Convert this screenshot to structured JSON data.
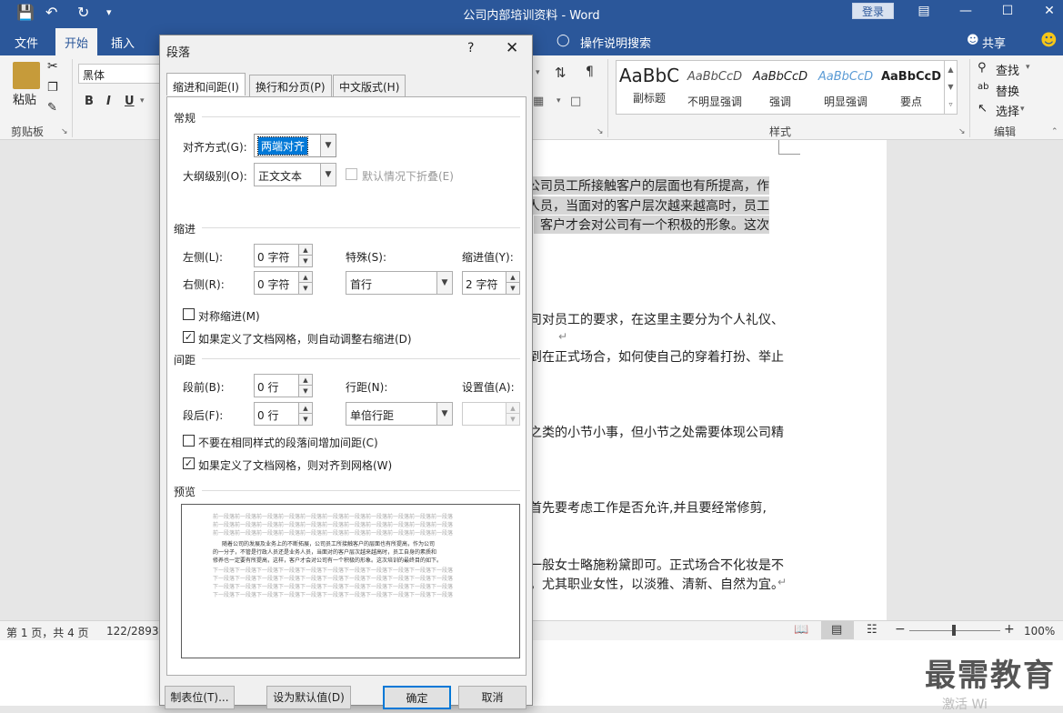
{
  "titlebar": {
    "title": "公司内部培训资料 - Word",
    "login": "登录"
  },
  "ribbon_tabs": [
    "文件",
    "开始",
    "插入",
    "操作说明搜索",
    "共享"
  ],
  "ribbon": {
    "paste": "粘贴",
    "clipboard": "剪贴板",
    "font_name": "黑体",
    "bold": "B",
    "italic": "I",
    "underline": "U",
    "styles_label": "样式",
    "styles": [
      {
        "sample": "AaBbC",
        "name": "副标题"
      },
      {
        "sample": "AaBbCcD",
        "name": "不明显强调"
      },
      {
        "sample": "AaBbCcD",
        "name": "强调"
      },
      {
        "sample": "AaBbCcD",
        "name": "明显强调"
      },
      {
        "sample": "AaBbCcD",
        "name": "要点"
      }
    ],
    "find": "查找",
    "replace": "替换",
    "select": "选择",
    "editing_label": "编辑"
  },
  "document": {
    "lines": [
      "公司员工所接触客户的层面也有所提高，作",
      "人员，当面对的客户层次越来越高时，员工",
      "客户才会对公司有一个积极的形象。这次",
      "司对员工的要求，在这里主要分为个人礼仪、",
      "到在正式场合，如何使自己的穿着打扮、举止",
      "之类的小节小事，但小节之处需要体现公司精",
      "首先要考虑工作是否允许,并且要经常修剪,",
      "一般女士略施粉黛即可。正式场合不化妆是不",
      "。尤其职业女性，以淡雅、清新、自然为宜。"
    ]
  },
  "statusbar": {
    "page": "第 1 页，共 4 页",
    "words": "122/2893",
    "zoom": "100%"
  },
  "watermark": "最需教育",
  "watermark_sub": "激活 Wi",
  "dialog": {
    "title": "段落",
    "help": "?",
    "tabs": [
      "缩进和间距(I)",
      "换行和分页(P)",
      "中文版式(H)"
    ],
    "sections": {
      "general": "常规",
      "indent": "缩进",
      "spacing": "间距",
      "preview": "预览"
    },
    "fields": {
      "alignment_label": "对齐方式(G):",
      "alignment_value": "两端对齐",
      "outline_label": "大纲级别(O):",
      "outline_value": "正文文本",
      "collapse_label": "默认情况下折叠(E)",
      "left_label": "左侧(L):",
      "left_value": "0 字符",
      "right_label": "右侧(R):",
      "right_value": "0 字符",
      "special_label": "特殊(S):",
      "special_value": "首行",
      "indent_by_label": "缩进值(Y):",
      "indent_by_value": "2 字符",
      "mirror_label": "对称缩进(M)",
      "auto_right_label": "如果定义了文档网格，则自动调整右缩进(D)",
      "before_label": "段前(B):",
      "before_value": "0 行",
      "after_label": "段后(F):",
      "after_value": "0 行",
      "line_spacing_label": "行距(N):",
      "line_spacing_value": "单倍行距",
      "at_label": "设置值(A):",
      "at_value": "",
      "no_space_label": "不要在相同样式的段落间增加间距(C)",
      "snap_grid_label": "如果定义了文档网格，则对齐到网格(W)"
    },
    "checks": {
      "collapse": false,
      "mirror": false,
      "auto_right": true,
      "no_space": false,
      "snap_grid": true
    },
    "preview_text": {
      "prev": "前一段落前一段落前一段落前一段落前一段落前一段落前一段落前一段落前一段落前一段落前一段落",
      "body1": "随着公司的发展及业务上的不断拓展，公司员工所接触客户的层面也有所提高，作为公司",
      "body2": "的一分子，不管是行政人员还是业务人员，当面对的客户层次越来越高时，员工自身的素质和",
      "body3": "修养也一定要有所提高，这样，客户才会对公司有一个积极的形象。这次培训的最终目的如下。",
      "next": "下一段落下一段落下一段落下一段落下一段落下一段落下一段落下一段落下一段落下一段落下一段落"
    },
    "buttons": {
      "tabs": "制表位(T)...",
      "default": "设为默认值(D)",
      "ok": "确定",
      "cancel": "取消"
    }
  }
}
